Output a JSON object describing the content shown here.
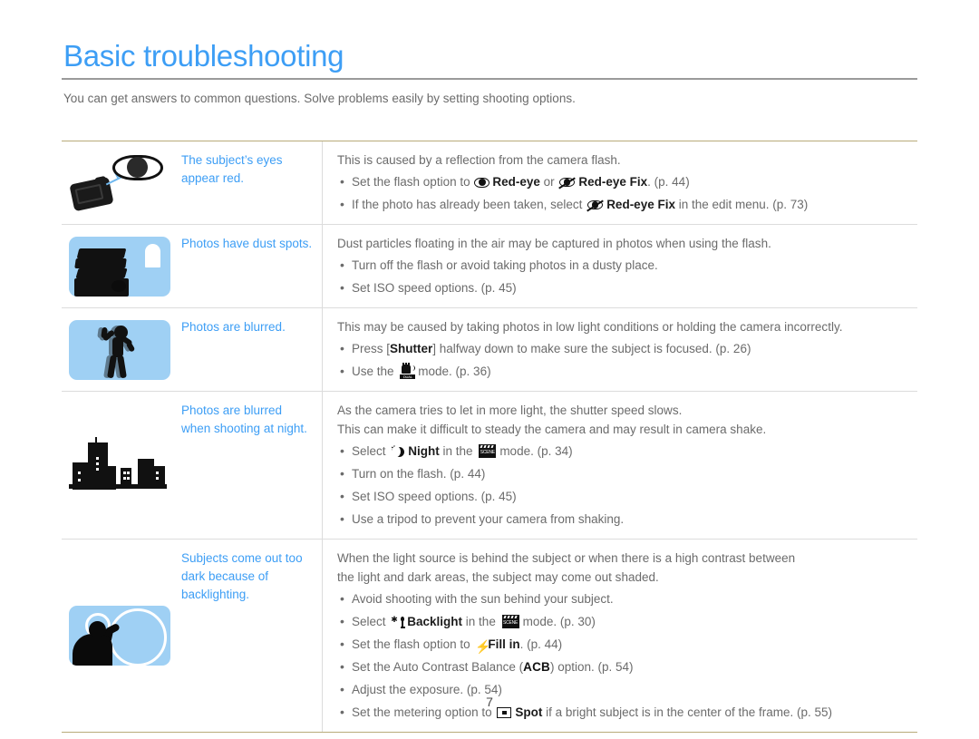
{
  "page": {
    "title": "Basic troubleshooting",
    "intro": "You can get answers to common questions. Solve problems easily by setting shooting options.",
    "folio": "7",
    "colors": {
      "heading": "#3d9ef5",
      "symptom": "#3d9ef5",
      "body_text": "#6b6b6b",
      "table_outer_rule": "#b8ab7a",
      "table_inner_rule": "#dcdcdc",
      "illustration_bg": "#9fd0f4"
    }
  },
  "table": {
    "rows": [
      {
        "illustration": "camera-flash-red-eye-illustration",
        "symptom": "The subject’s eyes appear red.",
        "lead": [
          "This is caused by a reflection from the camera flash."
        ],
        "bullets": [
          {
            "segments": [
              {
                "text": "Set the flash option to ",
                "style": "normal"
              },
              {
                "icon": "red-eye-icon"
              },
              {
                "text": "Red-eye",
                "style": "bold"
              },
              {
                "text": " or ",
                "style": "normal"
              },
              {
                "icon": "red-eye-fix-icon"
              },
              {
                "text": "Red-eye Fix",
                "style": "bold"
              },
              {
                "text": ". (p. 44)",
                "style": "normal"
              }
            ]
          },
          {
            "segments": [
              {
                "text": "If the photo has already been taken, select ",
                "style": "normal"
              },
              {
                "icon": "red-eye-fix-icon"
              },
              {
                "text": "Red-eye Fix",
                "style": "bold"
              },
              {
                "text": " in the edit menu. (p. 73)",
                "style": "normal"
              }
            ]
          }
        ]
      },
      {
        "illustration": "dust-spots-books-illustration",
        "symptom": "Photos have dust spots.",
        "lead": [
          "Dust particles floating in the air may be captured in photos when using the flash."
        ],
        "bullets": [
          {
            "segments": [
              {
                "text": "Turn off the flash or avoid taking photos in a dusty place.",
                "style": "normal"
              }
            ]
          },
          {
            "segments": [
              {
                "text": "Set ISO speed options. (p. 45)",
                "style": "normal"
              }
            ]
          }
        ]
      },
      {
        "illustration": "blurred-person-illustration",
        "symptom": "Photos are blurred.",
        "lead": [
          "This may be caused by taking photos in low light conditions or holding the camera incorrectly."
        ],
        "bullets": [
          {
            "segments": [
              {
                "text": "Press [",
                "style": "normal"
              },
              {
                "text": "Shutter",
                "style": "bold"
              },
              {
                "text": "] halfway down to make sure the subject is focused. (p. 26)",
                "style": "normal"
              }
            ]
          },
          {
            "segments": [
              {
                "text": "Use the ",
                "style": "normal"
              },
              {
                "icon": "dual-is-icon"
              },
              {
                "text": "mode. (p. 36)",
                "style": "normal"
              }
            ]
          }
        ]
      },
      {
        "illustration": "night-city-skyline-illustration",
        "symptom": "Photos are blurred when shooting at night.",
        "lead": [
          "As the camera tries to let in more light, the shutter speed slows.",
          "This can make it difficult to steady the camera and may result in camera shake."
        ],
        "bullets": [
          {
            "segments": [
              {
                "text": "Select ",
                "style": "normal"
              },
              {
                "icon": "night-mode-icon"
              },
              {
                "text": "Night",
                "style": "bold"
              },
              {
                "text": " in the ",
                "style": "normal"
              },
              {
                "icon": "scene-mode-icon"
              },
              {
                "text": "mode. (p. 34)",
                "style": "normal"
              }
            ]
          },
          {
            "segments": [
              {
                "text": "Turn on the flash. (p. 44)",
                "style": "normal"
              }
            ]
          },
          {
            "segments": [
              {
                "text": "Set ISO speed options. (p. 45)",
                "style": "normal"
              }
            ]
          },
          {
            "segments": [
              {
                "text": "Use a tripod to prevent your camera from shaking.",
                "style": "normal"
              }
            ]
          }
        ]
      },
      {
        "illustration": "backlighting-photographer-illustration",
        "symptom": "Subjects come out too dark because of backlighting.",
        "lead": [
          "When the light source is behind the subject or when there is a high contrast between",
          "the light and dark areas, the subject may come out shaded."
        ],
        "bullets": [
          {
            "segments": [
              {
                "text": "Avoid shooting with the sun behind your subject.",
                "style": "normal"
              }
            ]
          },
          {
            "segments": [
              {
                "text": "Select ",
                "style": "normal"
              },
              {
                "icon": "backlight-icon"
              },
              {
                "text": "Backlight",
                "style": "bold"
              },
              {
                "text": " in the ",
                "style": "normal"
              },
              {
                "icon": "scene-mode-icon"
              },
              {
                "text": "mode. (p. 30)",
                "style": "normal"
              }
            ]
          },
          {
            "segments": [
              {
                "text": "Set the flash option to ",
                "style": "normal"
              },
              {
                "icon": "fill-in-flash-icon"
              },
              {
                "text": "Fill in",
                "style": "bold"
              },
              {
                "text": ". (p. 44)",
                "style": "normal"
              }
            ]
          },
          {
            "segments": [
              {
                "text": "Set the Auto Contrast Balance (",
                "style": "normal"
              },
              {
                "text": "ACB",
                "style": "bold"
              },
              {
                "text": ") option. (p. 54)",
                "style": "normal"
              }
            ]
          },
          {
            "segments": [
              {
                "text": "Adjust the exposure. (p. 54)",
                "style": "normal"
              }
            ]
          },
          {
            "segments": [
              {
                "text": "Set the metering option to ",
                "style": "normal"
              },
              {
                "icon": "spot-metering-icon"
              },
              {
                "text": "Spot",
                "style": "bold"
              },
              {
                "text": " if a bright subject is in the center of the frame. (p. 55)",
                "style": "normal"
              }
            ]
          }
        ]
      }
    ]
  }
}
